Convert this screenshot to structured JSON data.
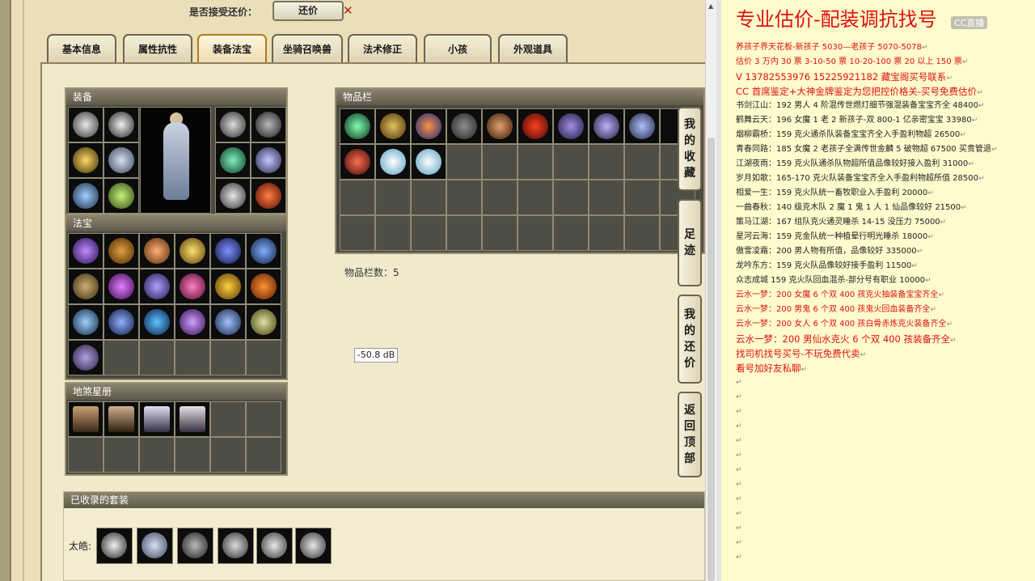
{
  "top_bar": {
    "accept_label": "是否接受还价：",
    "counter_button": "还价",
    "cross": "✕"
  },
  "tabs": [
    {
      "label": "基本信息",
      "active": false
    },
    {
      "label": "属性抗性",
      "active": false
    },
    {
      "label": "装备法宝",
      "active": true
    },
    {
      "label": "坐骑召唤兽",
      "active": false
    },
    {
      "label": "法术修正",
      "active": false
    },
    {
      "label": "小孩",
      "active": false
    },
    {
      "label": "外观道具",
      "active": false
    }
  ],
  "equip": {
    "title": "装备"
  },
  "fabao": {
    "title": "法宝"
  },
  "dishang": {
    "title": "地煞星册"
  },
  "inventory": {
    "title": "物品栏",
    "count_text": "物品栏数：5"
  },
  "tooltip": "-50.8 dB",
  "side_buttons": [
    {
      "label": "我的收藏"
    },
    {
      "label": "足迹"
    },
    {
      "label": "我的还价"
    },
    {
      "label": "返回顶部"
    }
  ],
  "suits": {
    "title": "已收录的套装",
    "label": "太皓:"
  },
  "right": {
    "title": "专业估价-配装调抗找号",
    "logo": "CC直播",
    "lines": [
      {
        "text": "养孩子界天花板-新孩子 5030—老孩子 5070-5078",
        "style": "red"
      },
      {
        "text": "估价 3 万内 30 票  3-10-50 票  10-20-100 票  20 以上 150 票",
        "style": "red"
      },
      {
        "text": "V 13782553976   15225921182  藏宝阁买号联系",
        "style": "red big"
      },
      {
        "text": "CC 首席鉴定+大神金牌鉴定为您把控价格关-买号免费估价",
        "style": "red big"
      },
      {
        "text": "书剑江山：192 男人 4 阶混传世燃灯细节强混装备宝宝齐全 48400",
        "style": ""
      },
      {
        "text": "鹤舞云天：196 女魔 1 老 2 新孩子-双 800-1 亿亲密宝宝 33980",
        "style": ""
      },
      {
        "text": "烟柳霸桥：159 克火通杀队装备宝宝齐全入手盈利物超 26500",
        "style": ""
      },
      {
        "text": "青春同路：185 女魔 2 老孩子全满传世金麟 5 破物超 67500 买贵管退",
        "style": ""
      },
      {
        "text": "江湖夜雨：159 克火队通杀队物超所值品像较好接入盈利 31000",
        "style": ""
      },
      {
        "text": "岁月如歌：165-170 克火队装备宝宝齐全入手盈利物超所值 28500",
        "style": ""
      },
      {
        "text": "相爱一生：159 克火队统一畜牧职业入手盈利 20000",
        "style": ""
      },
      {
        "text": "一曲春秋：140 级克木队 2 魔 1 鬼 1 人 1 仙品像较好 21500",
        "style": ""
      },
      {
        "text": "策马江湖：167 组队克火通灵睡杀 14-15 没压力 75000",
        "style": ""
      },
      {
        "text": "星河云海：159 克金队统一种植晕行明光睡杀 18000",
        "style": ""
      },
      {
        "text": "傲雪凌霜：200 男人物有所值，品像较好 335000",
        "style": ""
      },
      {
        "text": "龙吟东方：159 克火队品像较好接手盈利 11500",
        "style": ""
      },
      {
        "text": "众志成城 159 克火队回血混杀-部分号有职业 10000",
        "style": ""
      },
      {
        "text": "云水一梦：200 女魔 6 个双 400 孩克火抽装备宝宝齐全",
        "style": "red"
      },
      {
        "text": "云水一梦：200 男鬼 6 个双 400 孩鬼火回血装备齐全",
        "style": "red"
      },
      {
        "text": "云水一梦：200 女人 6 个双 400 孩白骨赤炼克火装备齐全",
        "style": "red"
      },
      {
        "text": "云水一梦：200 男仙水克火 6 个双 400 孩装备齐全",
        "style": "red big"
      },
      {
        "text": "找司机找号买号-不玩免费代卖",
        "style": "red big"
      },
      {
        "text": "看号加好友私聊",
        "style": "red big"
      }
    ],
    "paragraph_mark": "↵"
  }
}
